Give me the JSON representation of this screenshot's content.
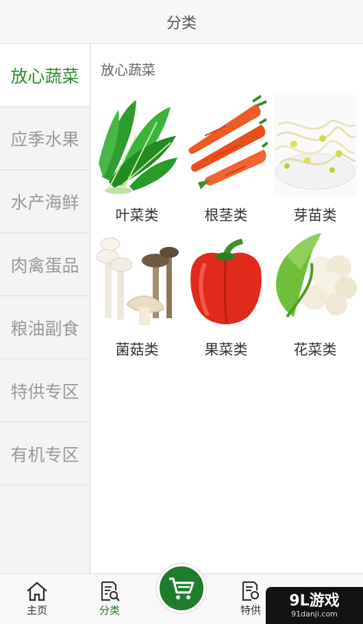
{
  "header": {
    "title": "分类"
  },
  "sidebar": {
    "items": [
      {
        "label": "放心蔬菜",
        "active": true
      },
      {
        "label": "应季水果",
        "active": false
      },
      {
        "label": "水产海鲜",
        "active": false
      },
      {
        "label": "肉禽蛋品",
        "active": false
      },
      {
        "label": "粮油副食",
        "active": false
      },
      {
        "label": "特供专区",
        "active": false
      },
      {
        "label": "有机专区",
        "active": false
      }
    ]
  },
  "content": {
    "section_title": "放心蔬菜",
    "categories": [
      {
        "label": "叶菜类",
        "icon": "leafy-greens-image"
      },
      {
        "label": "根茎类",
        "icon": "carrot-image"
      },
      {
        "label": "芽苗类",
        "icon": "bean-sprouts-image"
      },
      {
        "label": "菌菇类",
        "icon": "mushrooms-image"
      },
      {
        "label": "果菜类",
        "icon": "bell-pepper-image"
      },
      {
        "label": "花菜类",
        "icon": "cauliflower-image"
      }
    ]
  },
  "tabbar": {
    "home_label": "主页",
    "category_label": "分类",
    "special_label": "特供",
    "accent": "#1e7d2a"
  },
  "watermark": {
    "main": "9L游戏",
    "sub": "91danji.com"
  },
  "colors": {
    "active_text": "#2e8b2e",
    "inactive_text": "#999999"
  }
}
